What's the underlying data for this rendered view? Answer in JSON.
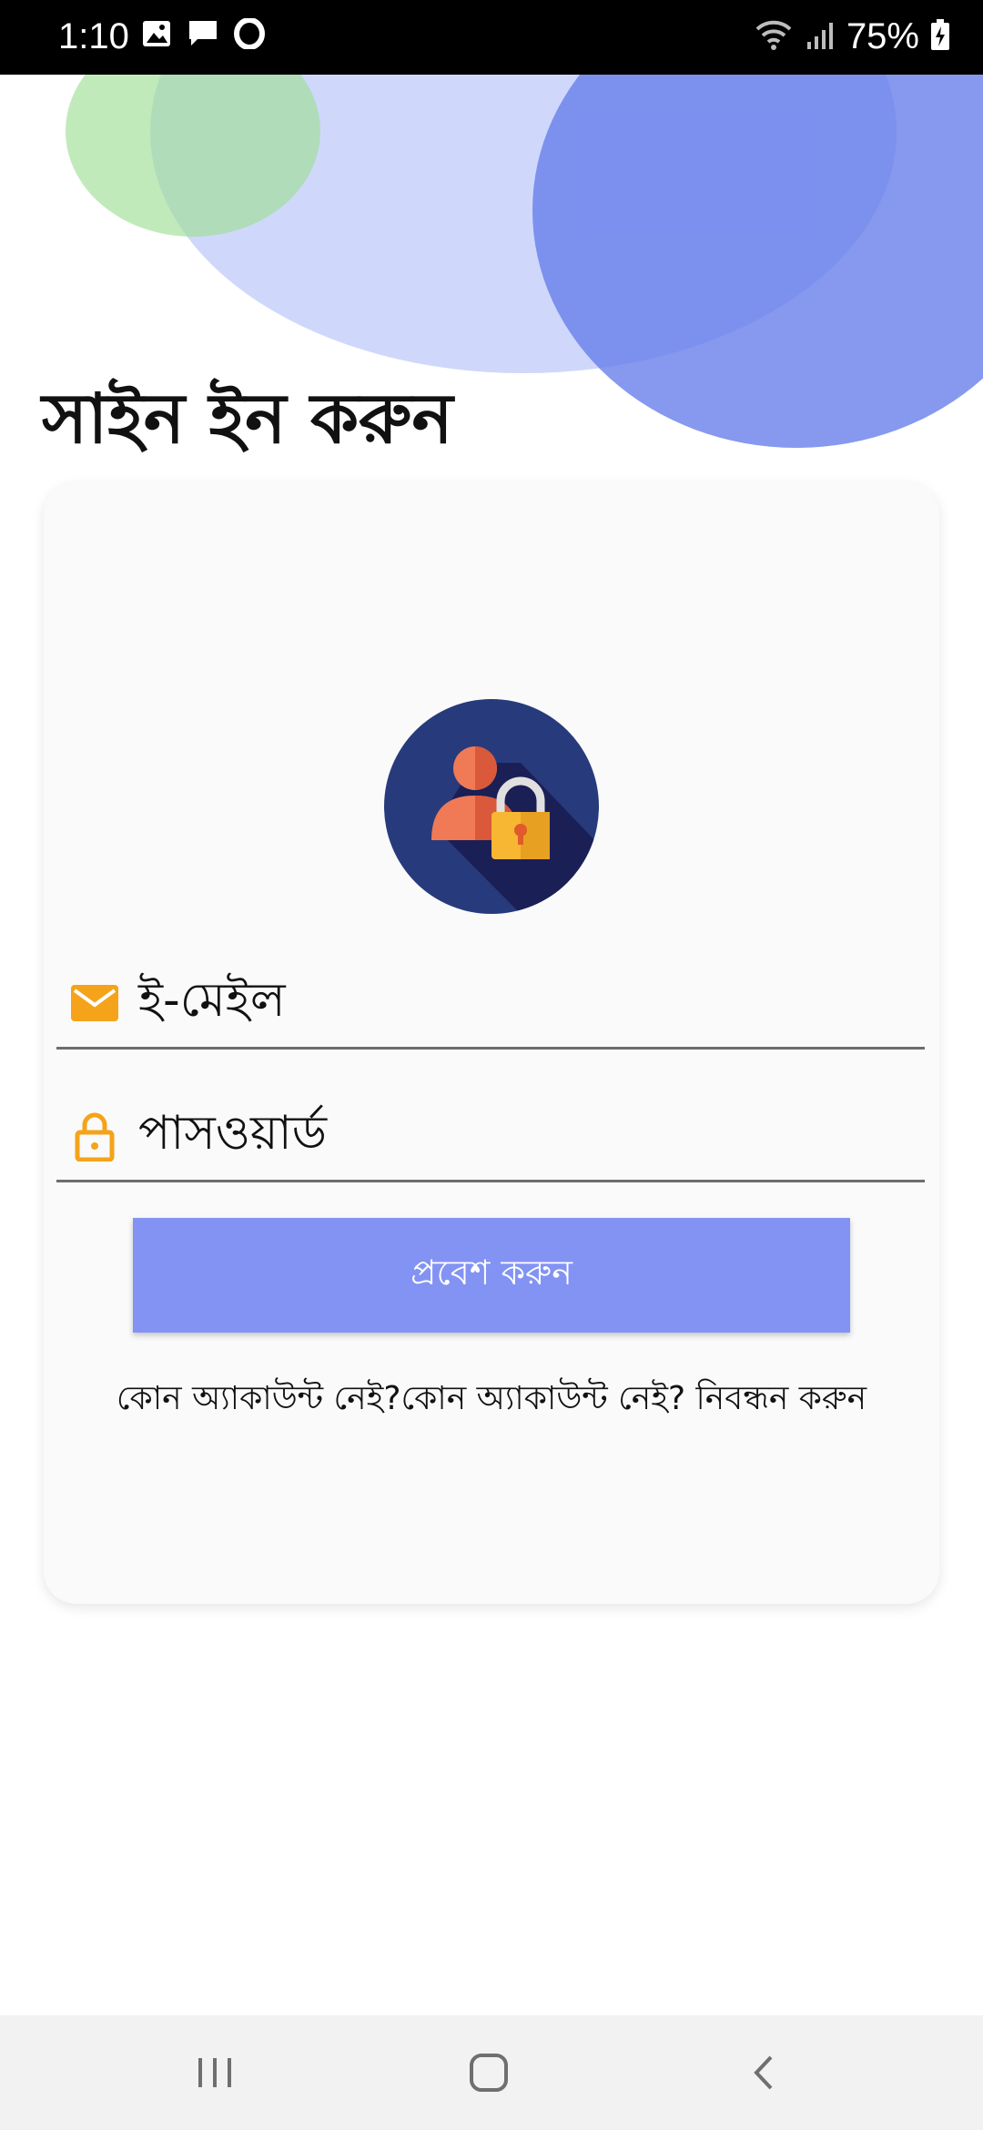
{
  "status_bar": {
    "time": "1:10",
    "battery": "75%",
    "left_icons": [
      "gallery-icon",
      "message-icon",
      "opera-icon"
    ],
    "right_icons": [
      "wifi-icon",
      "signal-icon",
      "battery-icon"
    ]
  },
  "decor": {
    "light_circle_color": "#cfd8fb",
    "green_circle_color": "#a0df96",
    "blue_circle_color": "#647ceb"
  },
  "title": "সাইন ইন করুন",
  "form": {
    "avatar_icon": "user-lock-icon",
    "email_label": "ই-মেইল",
    "email_icon": "mail-icon",
    "password_label": "পাসওয়ার্ড",
    "password_icon": "lock-icon",
    "login_button": "প্রবেশ করুন",
    "register_prompt": "কোন অ্যাকাউন্ট নেই?কোন অ্যাকাউন্ট নেই? নিবন্ধন করুন",
    "accent_color": "#f5a31a",
    "button_color": "#8393f3"
  },
  "nav_bar": {
    "recent_icon": "recent-apps-icon",
    "home_icon": "home-icon",
    "back_icon": "back-icon"
  }
}
